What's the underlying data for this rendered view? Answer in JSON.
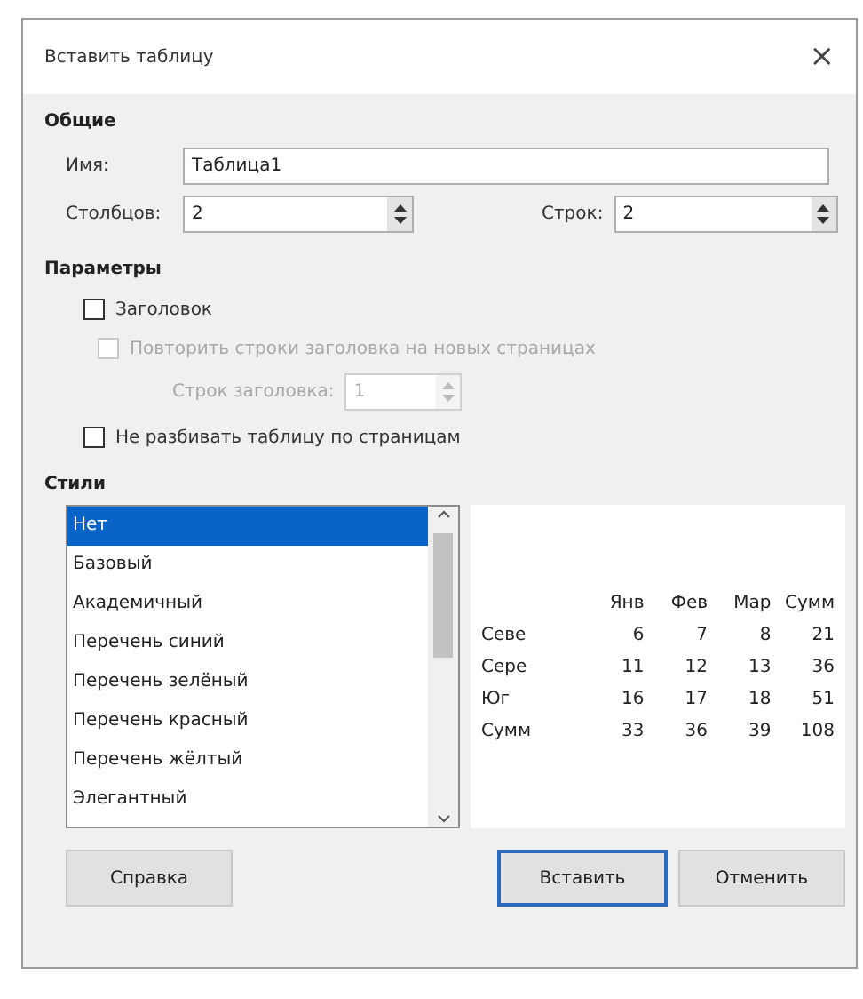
{
  "window": {
    "title": "Вставить таблицу",
    "close": "×"
  },
  "general": {
    "heading": "Общие",
    "name_label": "Имя:",
    "name_value": "Таблица1",
    "columns_label": "Столбцов:",
    "columns_value": "2",
    "rows_label": "Строк:",
    "rows_value": "2"
  },
  "options": {
    "heading": "Параметры",
    "header_check": {
      "label": "Заголовок",
      "checked": false,
      "disabled": false
    },
    "repeat_check": {
      "label": "Повторить строки заголовка на новых страницах",
      "checked": false,
      "disabled": true
    },
    "header_rows": {
      "label": "Строк заголовка:",
      "value": "1",
      "disabled": true
    },
    "no_split": {
      "label": "Не разбивать таблицу по страницам",
      "checked": false,
      "disabled": false
    }
  },
  "styles": {
    "heading": "Стили",
    "items": [
      {
        "label": "Нет",
        "selected": true
      },
      {
        "label": "Базовый",
        "selected": false
      },
      {
        "label": "Академичный",
        "selected": false
      },
      {
        "label": "Перечень синий",
        "selected": false
      },
      {
        "label": "Перечень зелёный",
        "selected": false
      },
      {
        "label": "Перечень красный",
        "selected": false
      },
      {
        "label": "Перечень жёлтый",
        "selected": false
      },
      {
        "label": "Элегантный",
        "selected": false
      }
    ]
  },
  "preview": {
    "columns": [
      "",
      "Янв",
      "Фев",
      "Мар",
      "Сумм"
    ],
    "rows": [
      [
        "Севе",
        "6",
        "7",
        "8",
        "21"
      ],
      [
        "Сере",
        "11",
        "12",
        "13",
        "36"
      ],
      [
        "Юг",
        "16",
        "17",
        "18",
        "51"
      ],
      [
        "Сумм",
        "33",
        "36",
        "39",
        "108"
      ]
    ]
  },
  "buttons": [
    {
      "label": "Справка",
      "default": false
    },
    {
      "label": "Вставить",
      "default": true
    },
    {
      "label": "Отменить",
      "default": false
    }
  ]
}
